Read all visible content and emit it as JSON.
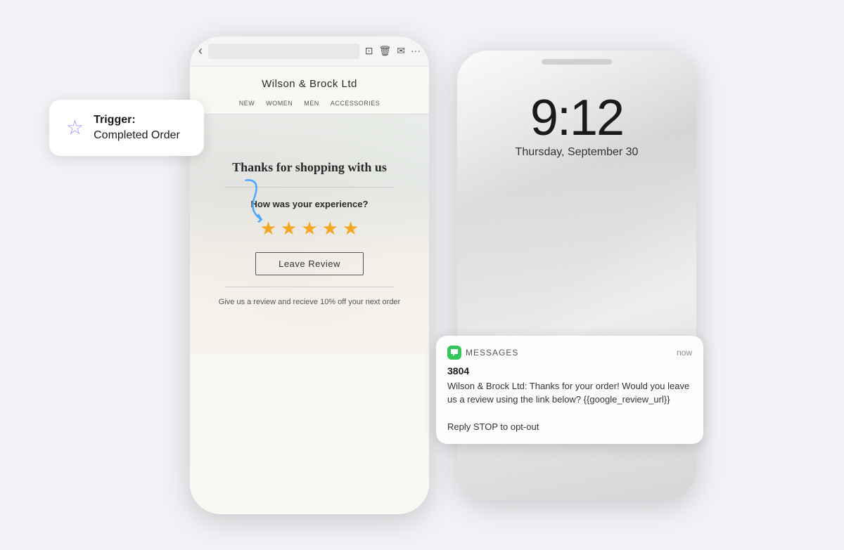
{
  "trigger": {
    "icon": "☆",
    "label_bold": "Trigger:",
    "label_text": "Completed Order"
  },
  "email_phone": {
    "brand": "Wilson & Brock Ltd",
    "nav_items": [
      "NEW",
      "WOMEN",
      "MEN",
      "ACCESSORIES"
    ],
    "hero_title": "Thanks for shopping with us",
    "question": "How was your experience?",
    "stars_count": 5,
    "review_button": "Leave Review",
    "footnote": "Give us a review and recieve 10% off your next order"
  },
  "sms_phone": {
    "time": "9:12",
    "date": "Thursday, September 30",
    "notification": {
      "app_name": "MESSAGES",
      "time": "now",
      "sender": "3804",
      "body": "Wilson & Brock Ltd: Thanks for your order! Would you leave us a review using the link below? {{google_review_url}}\n\nReply STOP to opt-out"
    }
  }
}
